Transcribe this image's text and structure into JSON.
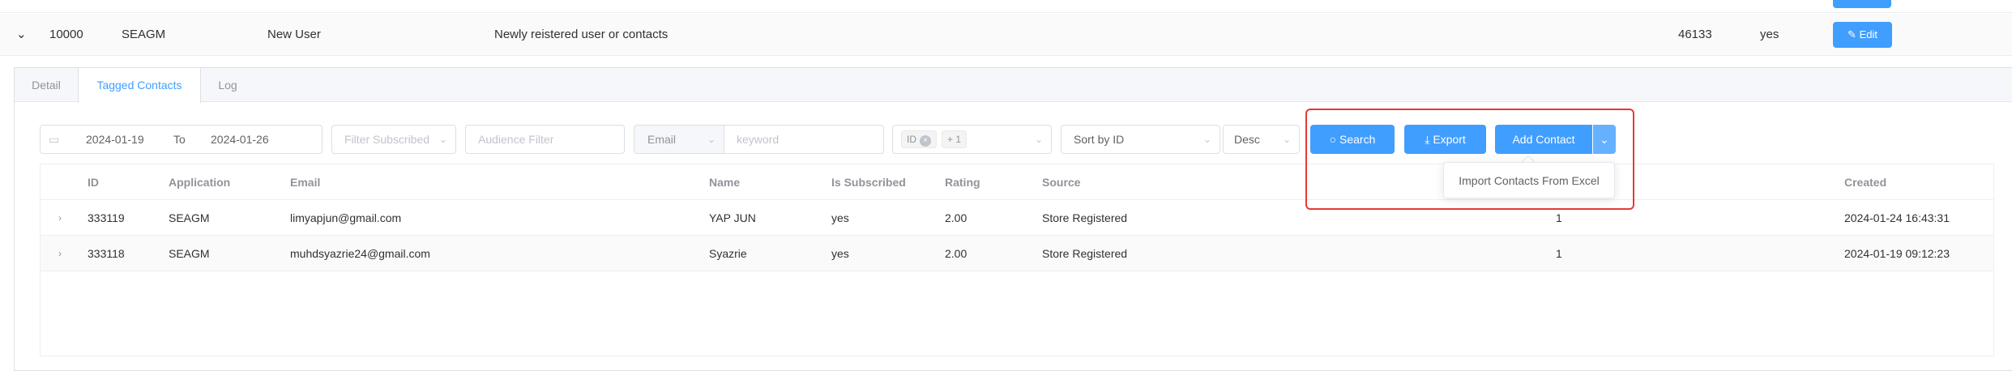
{
  "parent_row": {
    "chevron": "⌄",
    "id": "10000",
    "app": "SEAGM",
    "name": "New User",
    "description": "Newly reistered user or contacts",
    "count": "46133",
    "enabled": "yes",
    "edit_label": "Edit",
    "edit_icon": "✎"
  },
  "tabs": [
    {
      "label": "Detail"
    },
    {
      "label": "Tagged Contacts"
    },
    {
      "label": "Log"
    }
  ],
  "filters": {
    "date_icon": "▭",
    "date_start": "2024-01-19",
    "date_sep": "To",
    "date_end": "2024-01-26",
    "subscribed_placeholder": "Filter Subscribed",
    "audience_placeholder": "Audience Filter",
    "field_select": "Email",
    "keyword_placeholder": "keyword",
    "tag_id": "ID",
    "tag_more": "+ 1",
    "sort_by": "Sort by ID",
    "sort_order": "Desc",
    "arrow": "⌄"
  },
  "buttons": {
    "search": "Search",
    "search_icon": "○",
    "export": "Export",
    "export_icon": "⤓",
    "add_contact": "Add Contact",
    "split_icon": "⌄",
    "import_excel": "Import Contacts From Excel"
  },
  "table": {
    "headers": [
      "ID",
      "Application",
      "Email",
      "Name",
      "Is Subscribed",
      "Rating",
      "Source",
      "Created"
    ],
    "rows": [
      {
        "id": "333119",
        "app": "SEAGM",
        "email": "limyapjun@gmail.com",
        "name": "YAP JUN",
        "subscribed": "yes",
        "rating": "2.00",
        "source": "Store Registered",
        "extra": "1",
        "created": "2024-01-24 16:43:31"
      },
      {
        "id": "333118",
        "app": "SEAGM",
        "email": "muhdsyazrie24@gmail.com",
        "name": "Syazrie",
        "subscribed": "yes",
        "rating": "2.00",
        "source": "Store Registered",
        "extra": "1",
        "created": "2024-01-19 09:12:23"
      }
    ],
    "expand_icon": "›"
  },
  "colors": {
    "primary": "#409eff",
    "highlight": "#e53935"
  }
}
